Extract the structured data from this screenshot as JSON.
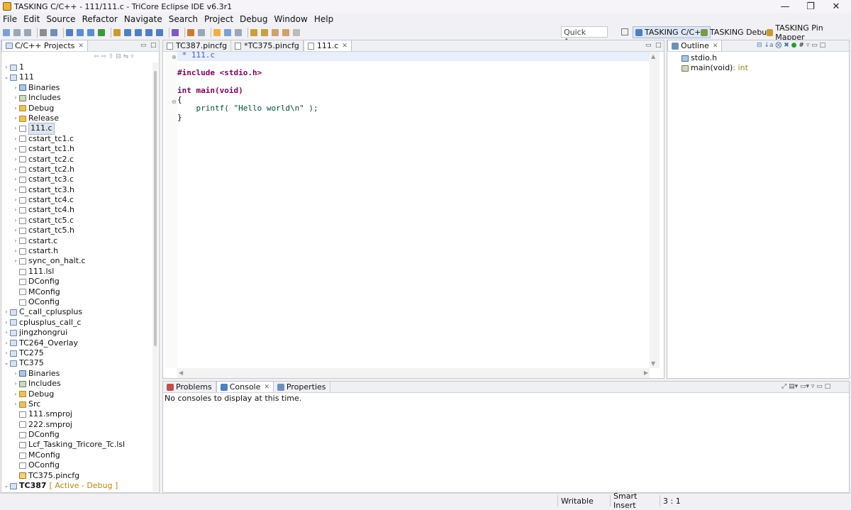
{
  "window": {
    "title": "TASKING C/C++ - 111/111.c - TriCore Eclipse IDE v6.3r1"
  },
  "menu": [
    "File",
    "Edit",
    "Source",
    "Refactor",
    "Navigate",
    "Search",
    "Project",
    "Debug",
    "Window",
    "Help"
  ],
  "quick_access": "Quick Access",
  "perspectives": [
    "TASKING C/C++",
    "TASKING Debug",
    "TASKING Pin Mapper"
  ],
  "project_explorer": {
    "title": "C/C++ Projects",
    "items": [
      {
        "label": "1",
        "indent": 0,
        "twisty": "›",
        "icon": "proj"
      },
      {
        "label": "111",
        "indent": 0,
        "twisty": "⌄",
        "icon": "proj"
      },
      {
        "label": "Binaries",
        "indent": 1,
        "twisty": "›",
        "icon": "bin"
      },
      {
        "label": "Includes",
        "indent": 1,
        "twisty": "›",
        "icon": "inc"
      },
      {
        "label": "Debug",
        "indent": 1,
        "twisty": "›",
        "icon": "folder"
      },
      {
        "label": "Release",
        "indent": 1,
        "twisty": "›",
        "icon": "folder"
      },
      {
        "label": "111.c",
        "indent": 1,
        "twisty": "›",
        "icon": "file",
        "selected": true
      },
      {
        "label": "cstart_tc1.c",
        "indent": 1,
        "twisty": "›",
        "icon": "file"
      },
      {
        "label": "cstart_tc1.h",
        "indent": 1,
        "twisty": "›",
        "icon": "file"
      },
      {
        "label": "cstart_tc2.c",
        "indent": 1,
        "twisty": "›",
        "icon": "file"
      },
      {
        "label": "cstart_tc2.h",
        "indent": 1,
        "twisty": "›",
        "icon": "file"
      },
      {
        "label": "cstart_tc3.c",
        "indent": 1,
        "twisty": "›",
        "icon": "file"
      },
      {
        "label": "cstart_tc3.h",
        "indent": 1,
        "twisty": "›",
        "icon": "file"
      },
      {
        "label": "cstart_tc4.c",
        "indent": 1,
        "twisty": "›",
        "icon": "file"
      },
      {
        "label": "cstart_tc4.h",
        "indent": 1,
        "twisty": "›",
        "icon": "file"
      },
      {
        "label": "cstart_tc5.c",
        "indent": 1,
        "twisty": "›",
        "icon": "file"
      },
      {
        "label": "cstart_tc5.h",
        "indent": 1,
        "twisty": "›",
        "icon": "file"
      },
      {
        "label": "cstart.c",
        "indent": 1,
        "twisty": "›",
        "icon": "file"
      },
      {
        "label": "cstart.h",
        "indent": 1,
        "twisty": "›",
        "icon": "file"
      },
      {
        "label": "sync_on_halt.c",
        "indent": 1,
        "twisty": "›",
        "icon": "file"
      },
      {
        "label": "111.lsl",
        "indent": 1,
        "twisty": "",
        "icon": "file"
      },
      {
        "label": "DConfig",
        "indent": 1,
        "twisty": "",
        "icon": "file"
      },
      {
        "label": "MConfig",
        "indent": 1,
        "twisty": "",
        "icon": "file"
      },
      {
        "label": "OConfig",
        "indent": 1,
        "twisty": "",
        "icon": "file"
      },
      {
        "label": "C_call_cplusplus",
        "indent": 0,
        "twisty": "›",
        "icon": "proj"
      },
      {
        "label": "cplusplus_call_c",
        "indent": 0,
        "twisty": "›",
        "icon": "proj"
      },
      {
        "label": "jingzhongrui",
        "indent": 0,
        "twisty": "›",
        "icon": "proj"
      },
      {
        "label": "TC264_Overlay",
        "indent": 0,
        "twisty": "›",
        "icon": "proj"
      },
      {
        "label": "TC275",
        "indent": 0,
        "twisty": "›",
        "icon": "proj"
      },
      {
        "label": "TC375",
        "indent": 0,
        "twisty": "⌄",
        "icon": "proj"
      },
      {
        "label": "Binaries",
        "indent": 1,
        "twisty": "›",
        "icon": "bin"
      },
      {
        "label": "Includes",
        "indent": 1,
        "twisty": "›",
        "icon": "inc"
      },
      {
        "label": "Debug",
        "indent": 1,
        "twisty": "›",
        "icon": "folder"
      },
      {
        "label": "Src",
        "indent": 1,
        "twisty": "›",
        "icon": "folder"
      },
      {
        "label": "111.smproj",
        "indent": 1,
        "twisty": "",
        "icon": "file"
      },
      {
        "label": "222.smproj",
        "indent": 1,
        "twisty": "",
        "icon": "file"
      },
      {
        "label": "DConfig",
        "indent": 1,
        "twisty": "",
        "icon": "file"
      },
      {
        "label": "Lcf_Tasking_Tricore_Tc.lsl",
        "indent": 1,
        "twisty": "",
        "icon": "file"
      },
      {
        "label": "MConfig",
        "indent": 1,
        "twisty": "",
        "icon": "file"
      },
      {
        "label": "OConfig",
        "indent": 1,
        "twisty": "",
        "icon": "file"
      },
      {
        "label": "TC375.pincfg",
        "indent": 1,
        "twisty": "",
        "icon": "pin"
      },
      {
        "label": "TC387",
        "indent": 0,
        "twisty": "⌄",
        "icon": "proj",
        "bold": true,
        "tag": "[ Active - Debug ]"
      }
    ]
  },
  "editor": {
    "tabs": [
      "TC387.pincfg",
      "*TC375.pincfg",
      "111.c"
    ],
    "lines": [
      {
        "text": " * 111.c",
        "cls": "cm"
      },
      {
        "text": "",
        "cls": ""
      },
      {
        "text": "#include <stdio.h>",
        "cls": "inc"
      },
      {
        "text": "",
        "cls": ""
      },
      {
        "text": "int main(void)",
        "cls": "fn"
      },
      {
        "text": "{",
        "cls": ""
      },
      {
        "text": "    printf( \"Hello world\\n\" );",
        "cls": "call"
      },
      {
        "text": "}",
        "cls": ""
      }
    ]
  },
  "outline": {
    "title": "Outline",
    "items": [
      {
        "label": "stdio.h",
        "type": ""
      },
      {
        "label": "main(void)",
        "type": " : int"
      }
    ]
  },
  "console": {
    "tabs": [
      "Problems",
      "Console",
      "Properties"
    ],
    "message": "No consoles to display at this time."
  },
  "status": {
    "writable": "Writable",
    "insert_mode": "Smart Insert",
    "position": "3 : 1"
  }
}
